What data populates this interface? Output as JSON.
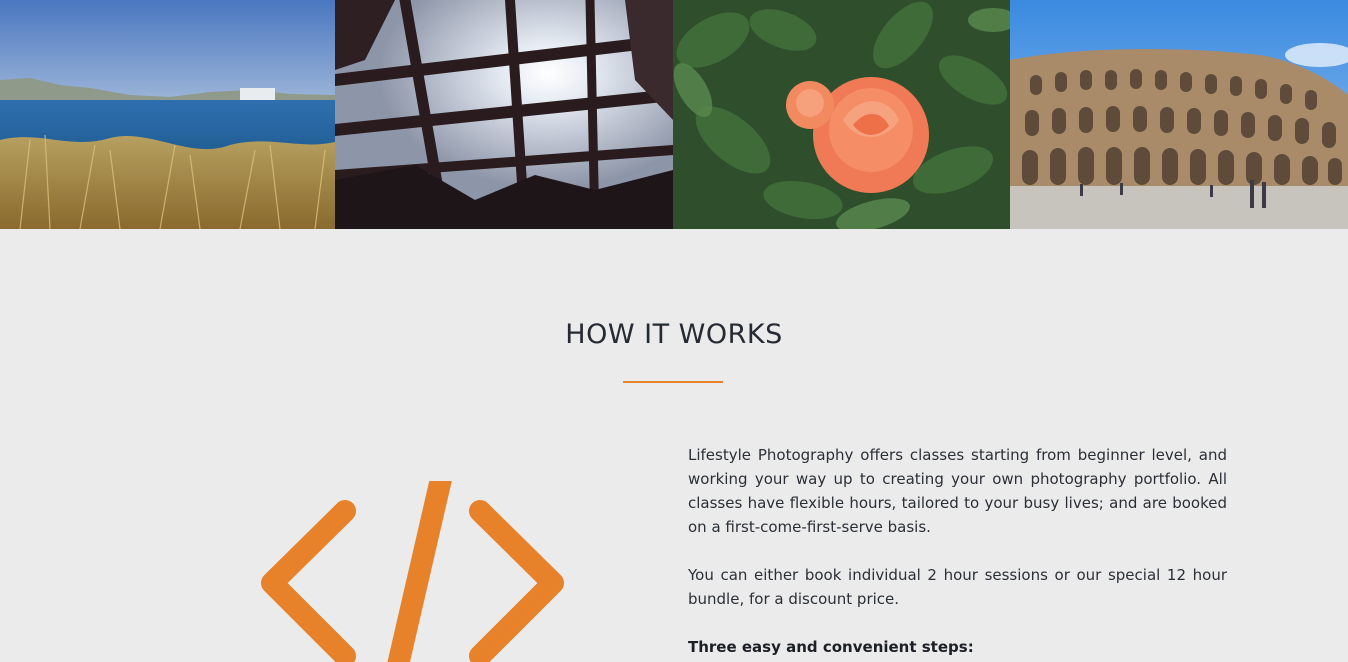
{
  "gallery": {
    "photos": [
      {
        "icon": "seaside-photo",
        "alt": ""
      },
      {
        "icon": "pergola-sun-photo",
        "alt": ""
      },
      {
        "icon": "rose-photo",
        "alt": ""
      },
      {
        "icon": "colosseum-photo",
        "alt": ""
      }
    ]
  },
  "how_it_works": {
    "title": "HOW IT WORKS",
    "icon": "code-brackets-icon",
    "accent_color": "#e8822a",
    "paragraph_1": "Lifestyle Photography offers classes starting from beginner level, and working your way up to creating your own photography portfolio. All classes have flexible hours, tailored to your busy lives; and are booked on a first-come-first-serve basis.",
    "paragraph_2": "You can either book individual 2 hour sessions or our special 12 hour bundle, for a discount price.",
    "steps_heading": "Three easy and convenient steps:"
  }
}
